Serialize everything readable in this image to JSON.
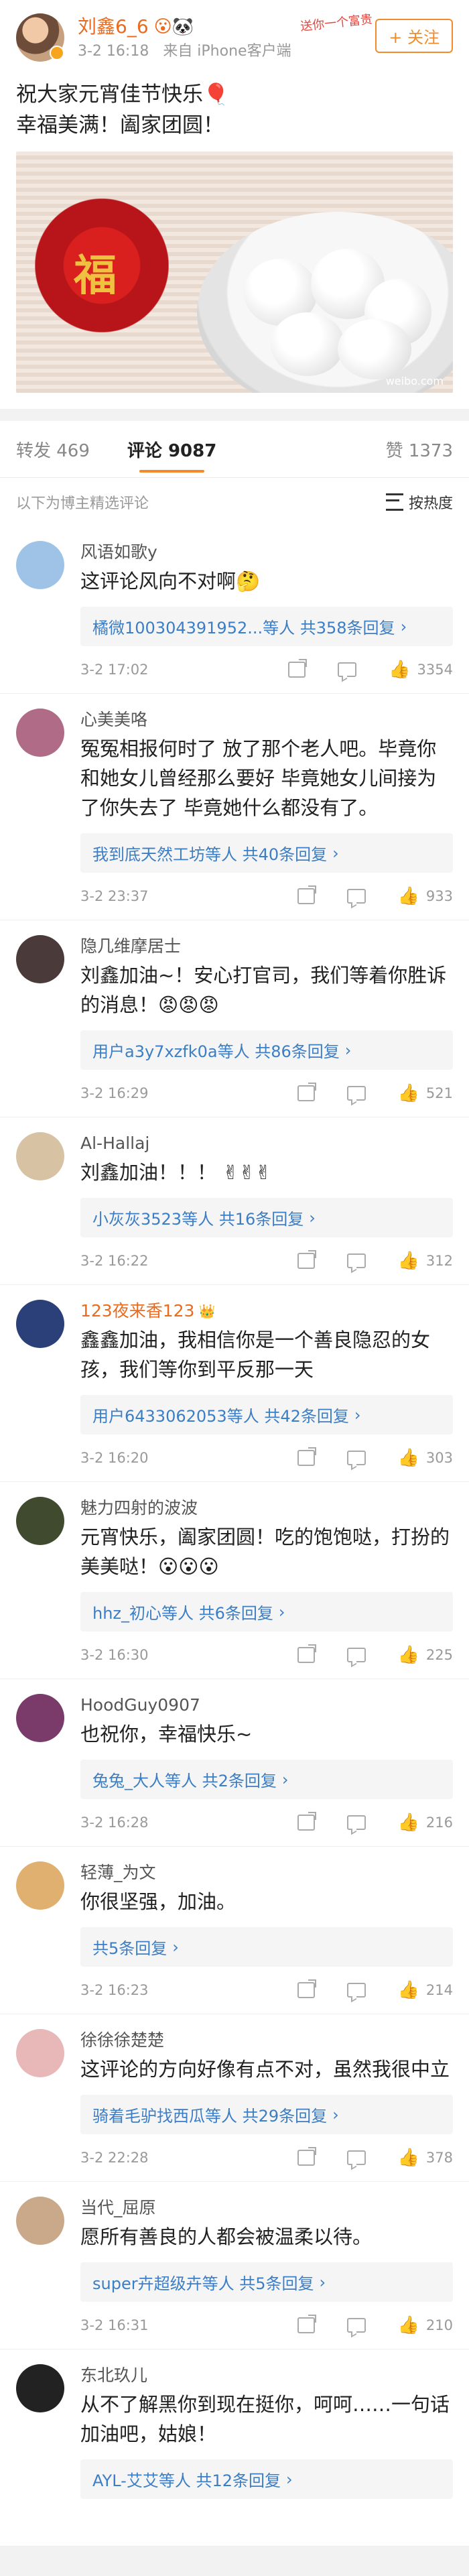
{
  "post": {
    "author": "刘鑫6_6",
    "author_emojis": "😮🐼",
    "time": "3-2 16:18",
    "source": "来自 iPhone客户端",
    "follow_label": "+ 关注",
    "watermark": "送你一个富贵",
    "text_line1": "祝大家元宵佳节快乐🎈",
    "text_line2": "幸福美满！阖家团圆！",
    "image_char": "福",
    "image_watermark": "weibo.com"
  },
  "tabs": {
    "repost": "转发 469",
    "comments": "评论 9087",
    "likes": "赞 1373"
  },
  "sort_bar": {
    "hint": "以下为博主精选评论",
    "toggle": "按热度"
  },
  "comments": [
    {
      "name": "风语如歌y",
      "text": "这评论风向不对啊🤔",
      "reply": "橘微100304391952...等人  共358条回复",
      "time": "3-2 17:02",
      "likes": "3354",
      "avatar": "#9fc3e6"
    },
    {
      "name": "心美美咯",
      "text": "冤冤相报何时了 放了那个老人吧。毕竟你和她女儿曾经那么要好 毕竟她女儿间接为了你失去了 毕竟她什么都没有了。",
      "reply": "我到底天然工坊等人  共40条回复",
      "time": "3-2 23:37",
      "likes": "933",
      "avatar": "#b06b87"
    },
    {
      "name": "隐几维摩居士",
      "text": "刘鑫加油~！安心打官司，我们等着你胜诉的消息！😡😡😡",
      "reply": "用户a3y7xzfk0a等人  共86条回复",
      "time": "3-2 16:29",
      "likes": "521",
      "avatar": "#4a3a3a"
    },
    {
      "name": "Al-Hallaj",
      "text": "刘鑫加油！！！ ✌✌✌",
      "reply": "小灰灰3523等人  共16条回复",
      "time": "3-2 16:22",
      "likes": "312",
      "avatar": "#d8c2a4"
    },
    {
      "name": "123夜来香123",
      "vip": true,
      "text": "鑫鑫加油，我相信你是一个善良隐忍的女孩，我们等你到平反那一天",
      "reply": "用户6433062053等人  共42条回复",
      "time": "3-2 16:20",
      "likes": "303",
      "avatar": "#2b3f78"
    },
    {
      "name": "魅力四射的波波",
      "text": "元宵快乐，阖家团圆！吃的饱饱哒，打扮的美美哒！😮😮😮",
      "reply": "hhz_初心等人  共6条回复",
      "time": "3-2 16:30",
      "likes": "225",
      "avatar": "#3f4a2e"
    },
    {
      "name": "HoodGuy0907",
      "text": "也祝你，幸福快乐~",
      "reply": "兔兔_大人等人  共2条回复",
      "time": "3-2 16:28",
      "likes": "216",
      "avatar": "#7a3a6a"
    },
    {
      "name": "轻薄_为文",
      "text": "你很坚强，加油。",
      "reply": "共5条回复",
      "time": "3-2 16:23",
      "likes": "214",
      "avatar": "#e0b070"
    },
    {
      "name": "徐徐徐楚楚",
      "text": "这评论的方向好像有点不对，虽然我很中立",
      "reply": "骑着毛驴找西瓜等人  共29条回复",
      "time": "3-2 22:28",
      "likes": "378",
      "avatar": "#e8b8b8"
    },
    {
      "name": "当代_屈原",
      "text": "愿所有善良的人都会被温柔以待。",
      "reply": "super卉超级卉等人  共5条回复",
      "time": "3-2 16:31",
      "likes": "210",
      "avatar": "#c9a98a"
    },
    {
      "name": "东北玖儿",
      "text": "从不了解黑你到现在挺你，呵呵……一句话加油吧，姑娘！",
      "reply": "AYL-艾艾等人  共12条回复",
      "time": "",
      "likes": "",
      "avatar": "#222222"
    }
  ]
}
